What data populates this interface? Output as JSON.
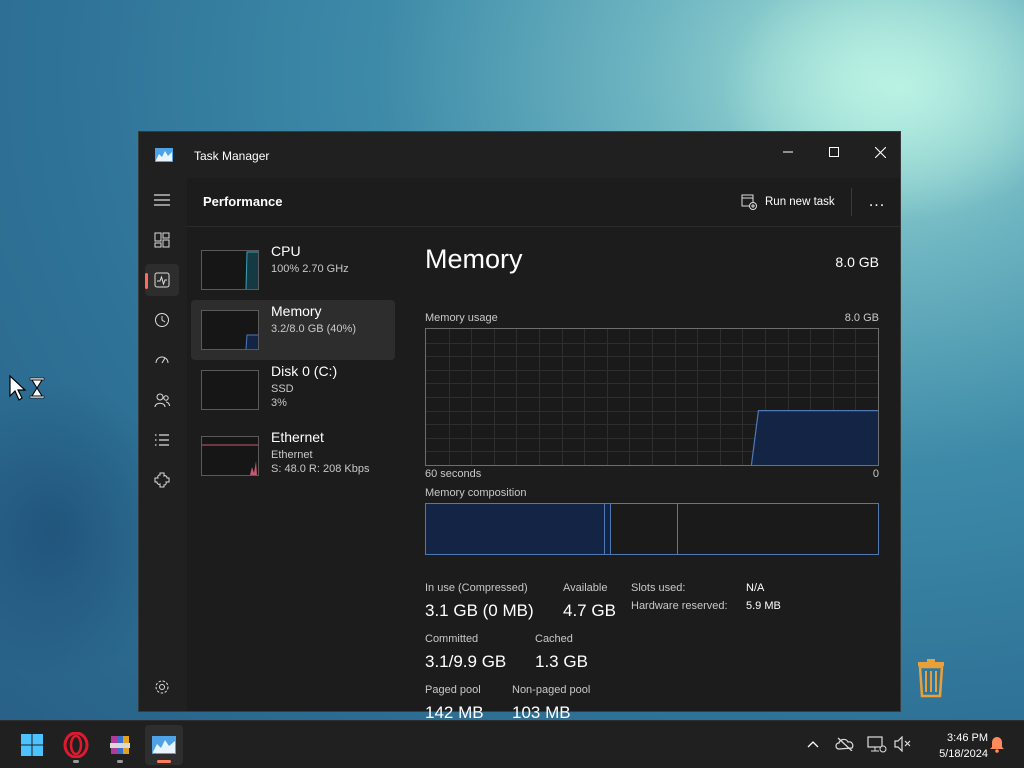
{
  "window": {
    "title": "Task Manager"
  },
  "header": {
    "page_title": "Performance",
    "run_new_task": "Run new task",
    "more": "..."
  },
  "nav": {
    "items": [
      "hamburger-icon",
      "processes-icon",
      "performance-icon",
      "app-history-icon",
      "startup-apps-icon",
      "users-icon",
      "details-icon",
      "services-icon"
    ],
    "active": "performance-icon",
    "accent": "#ff6b5e"
  },
  "perf_list": [
    {
      "name": "CPU",
      "line1": "100%  2.70 GHz",
      "line2": "",
      "selected": false
    },
    {
      "name": "Memory",
      "line1": "3.2/8.0 GB (40%)",
      "line2": "",
      "selected": true
    },
    {
      "name": "Disk 0 (C:)",
      "line1": "SSD",
      "line2": "3%",
      "selected": false
    },
    {
      "name": "Ethernet",
      "line1": "Ethernet",
      "line2": "S: 48.0  R: 208 Kbps",
      "selected": false
    }
  ],
  "detail": {
    "title": "Memory",
    "total": "8.0 GB",
    "usage_label": "Memory usage",
    "usage_max": "8.0 GB",
    "axis_left": "60 seconds",
    "axis_right": "0",
    "composition_label": "Memory composition",
    "usage_level": 0.4,
    "stats": {
      "in_use_label": "In use (Compressed)",
      "in_use_value": "3.1 GB (0 MB)",
      "available_label": "Available",
      "available_value": "4.7 GB",
      "committed_label": "Committed",
      "committed_value": "3.1/9.9 GB",
      "cached_label": "Cached",
      "cached_value": "1.3 GB",
      "paged_label": "Paged pool",
      "paged_value": "142 MB",
      "nonpaged_label": "Non-paged pool",
      "nonpaged_value": "103 MB",
      "slots_label": "Slots used:",
      "slots_value": "N/A",
      "hw_label": "Hardware reserved:",
      "hw_value": "5.9 MB"
    }
  },
  "colors": {
    "memory_line": "#4f79b5",
    "memory_fill": "#132445",
    "cpu_line": "#3a9fb5",
    "ethernet_line": "#c45a6e"
  },
  "taskbar": {
    "apps": [
      "windows-start-icon",
      "opera-icon",
      "winrar-icon",
      "task-manager-icon"
    ],
    "time": "3:46 PM",
    "date": "5/18/2024"
  }
}
